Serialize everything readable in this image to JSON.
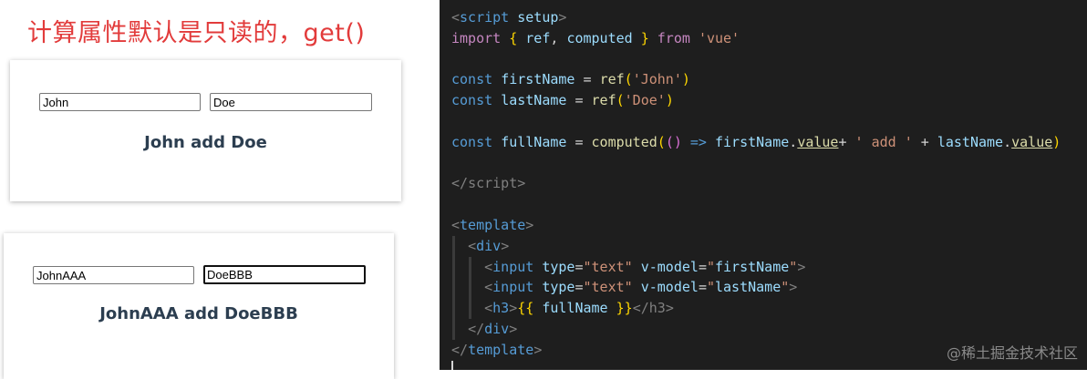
{
  "heading": "计算属性默认是只读的，get()",
  "panel1": {
    "first_value": "John",
    "last_value": "Doe",
    "result": "John add Doe"
  },
  "panel2": {
    "first_value": "JohnAAA",
    "last_value": "DoeBBB",
    "result": "JohnAAA add DoeBBB"
  },
  "editor": {
    "top_fragment": "  ·  ···  ···  ··· · ·"
  },
  "watermark": "@稀土掘金技术社区"
}
